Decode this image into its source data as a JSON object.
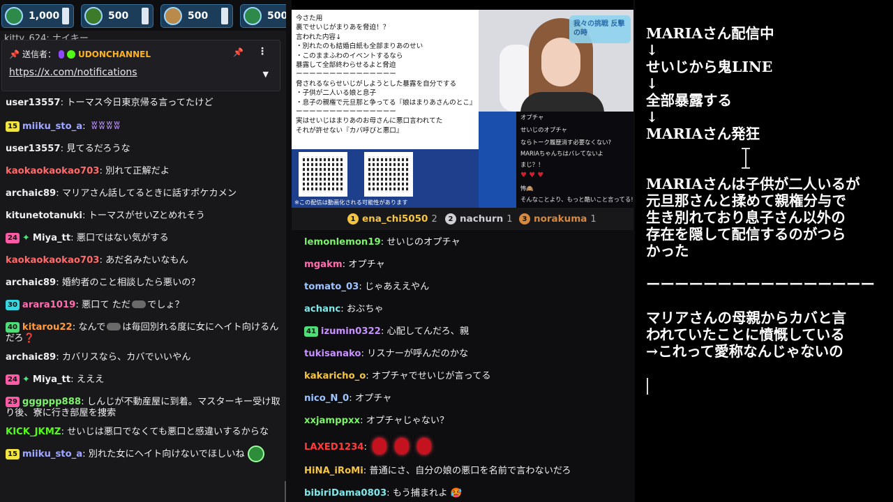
{
  "colors": {
    "bg": "#0e0e10",
    "chat_bg": "#18181b",
    "notes_bg": "#000000"
  },
  "gifts": [
    {
      "amount": "1,000",
      "icon": "gift-icon"
    },
    {
      "amount": "500",
      "icon": "gift-icon"
    },
    {
      "amount": "500",
      "icon": "gift-icon"
    },
    {
      "amount": "500",
      "icon": "gift-icon"
    }
  ],
  "left_chat": {
    "cut_message": "kitty_624: ナイキー",
    "pinned": {
      "sender_label": "送信者：",
      "sender": "UDONCHANNEL",
      "link": "https://x.com/notifications"
    },
    "messages": [
      {
        "user": "user13557",
        "color": "#efeff1",
        "text": ": トーマス今日東京帰る言ってたけど"
      },
      {
        "badge": "15",
        "badge_color": "#f0e442",
        "user": "miiku_sto_a",
        "color": "#a0a8ff",
        "text": ": ",
        "emote": "ʬʬʬʬ"
      },
      {
        "user": "user13557",
        "color": "#efeff1",
        "text": ": 見てるだろうな"
      },
      {
        "user": "kaokaokaokao703",
        "color": "#ff6b6b",
        "text": ": 別れて正解だよ"
      },
      {
        "user": "archaic89",
        "color": "#efeff1",
        "text": ": マリアさん話してるときに話すポケカメン"
      },
      {
        "user": "kitunetotanuki",
        "color": "#efeff1",
        "text": ": トーマスがせいZとめれそう"
      },
      {
        "badge": "24",
        "badge_color": "#ff5aa5",
        "spark": true,
        "user": "Miya_tt",
        "color": "#efeff1",
        "text": ": 悪口ではない気がする"
      },
      {
        "user": "kaokaokaokao703",
        "color": "#ff6b6b",
        "text": ": あだ名みたいなもん"
      },
      {
        "user": "archaic89",
        "color": "#efeff1",
        "text": ": 婚約者のこと相談したら悪いの？"
      },
      {
        "badge": "30",
        "badge_color": "#39d6e0",
        "user": "arara1019",
        "color": "#ff6fb0",
        "text": ": 悪口て ただ",
        "text2": "でしょ？"
      },
      {
        "badge": "40",
        "badge_color": "#4fdc79",
        "user": "kitarou22",
        "color": "#ff9b3d",
        "text": ": なんで",
        "text2": "は毎回別れる度に女にヘイト向けるんだろ",
        "mark": "❓",
        "wrap": true
      },
      {
        "user": "archaic89",
        "color": "#efeff1",
        "text": ": カバリスなら、カバでいいやん"
      },
      {
        "badge": "24",
        "badge_color": "#ff5aa5",
        "spark": true,
        "user": "Miya_tt",
        "color": "#efeff1",
        "text": ": えええ"
      },
      {
        "badge": "29",
        "badge_color": "#ff5aa5",
        "user": "gggppp888",
        "color": "#7cf26a",
        "text": ": しんじが不動産屋に到着。マスターキー受け取り後、寮に行き部屋を捜索",
        "wrap": true
      },
      {
        "user": "KICK_JKMZ",
        "color": "#53fc18",
        "text": ": せいじは悪口でなくても悪口と感違いするからな",
        "wrap": true
      },
      {
        "badge": "15",
        "badge_color": "#f0e442",
        "user": "miiku_sto_a",
        "color": "#a0a8ff",
        "text": ": 別れた女にヘイト向けないでほしいね",
        "avatar": true
      }
    ]
  },
  "stream": {
    "note_lines": [
      "今さた用",
      "裏でせいじがまりあを脅迫！？",
      "言われた内容↓",
      "・別れたのも結婚白紙も全部まりあのせい",
      "・このままふわのイベントするなら",
      "暴露して全部終わらせるよと脅迫",
      "ーーーーーーーーーーーーーーー",
      "脅されるならせいじがしようとした暴露を自分でする",
      "・子供が二人いる娘と息子",
      "・息子の親権で元旦那と争ってる『娘はまりあさんのとこ』",
      "ーーーーーーーーーーーーーーー",
      "実はせいじはまりあのお母さんに悪口言われてた",
      "それが許せない『カバ呼びと悪口』"
    ],
    "banner_text": "我々の挑戦 反撃の時",
    "qr_caption": "※この配信は動画化される可能性があります",
    "overlay_chat": [
      "オプチャ",
      "せいじのオプチャ",
      "ならトーク履歴消す必要なくない?",
      "MARIAちゃんちはバレてないよ",
      "まじ？！",
      "♥ ♥ ♥",
      "怖🙈",
      "そんなことより、もっと酷いこと言ってる!"
    ]
  },
  "leaderboard": [
    {
      "rank": "1",
      "color": "#f5c542",
      "name": "ena_chi5050",
      "count": "2"
    },
    {
      "rank": "2",
      "color": "#cfcfd4",
      "name": "nachurn",
      "count": "1"
    },
    {
      "rank": "3",
      "color": "#d78a3d",
      "name": "norakuma",
      "count": "1"
    }
  ],
  "center_chat": [
    {
      "user": "lemonlemon19",
      "color": "#7cf26a",
      "text": ": せいじのオプチャ"
    },
    {
      "user": "mgakm",
      "color": "#ff6fb0",
      "text": ": オプチャ"
    },
    {
      "user": "tomato_03",
      "color": "#9ec5ff",
      "text": ": じゃあええやん"
    },
    {
      "user": "achanc",
      "color": "#7fe7e7",
      "text": ": おぶちゃ"
    },
    {
      "badge": "41",
      "badge_color": "#4fdc79",
      "user": "izumin0322",
      "color": "#c792ff",
      "text": ": 心配してんだろ、親"
    },
    {
      "user": "tukisanako",
      "color": "#c792ff",
      "text": ": リスナーが呼んだのかな"
    },
    {
      "user": "kakaricho_o",
      "color": "#f5c542",
      "text": ": オプチャでせいじが言ってる"
    },
    {
      "user": "nico_N_0",
      "color": "#9ec5ff",
      "text": ": オプチャ"
    },
    {
      "user": "xxjamppxx",
      "color": "#7cf26a",
      "text": ": オプチャじゃない？"
    },
    {
      "user": "LAXED1234",
      "color": "#ff3b3b",
      "text": ":",
      "redemotes": 3
    },
    {
      "user": "HiNA_iRoMi",
      "color": "#f5c542",
      "text": ": 普通にさ、自分の娘の悪口を名前で言わないだろ"
    },
    {
      "user": "bibiriDama0803",
      "color": "#7fe7e7",
      "text": ": もう捕まれよ 🥵"
    }
  ],
  "notes": [
    "MARIAさん配信中",
    "↓",
    "せいじから鬼LINE",
    "↓",
    "全部暴露する",
    "↓",
    "MARIAさん発狂",
    "",
    "",
    "MARIAさんは子供が二人いるが",
    "元旦那さんと揉めて親権分与で",
    "生き別れており息子さん以外の",
    "存在を隠して配信するのがつら",
    "かった",
    "",
    "ーーーーーーーーーーーーーーーー",
    "",
    "マリアさんの母親からカバと言",
    "われていたことに憤慨している",
    "→これって愛称なんじゃないの"
  ]
}
